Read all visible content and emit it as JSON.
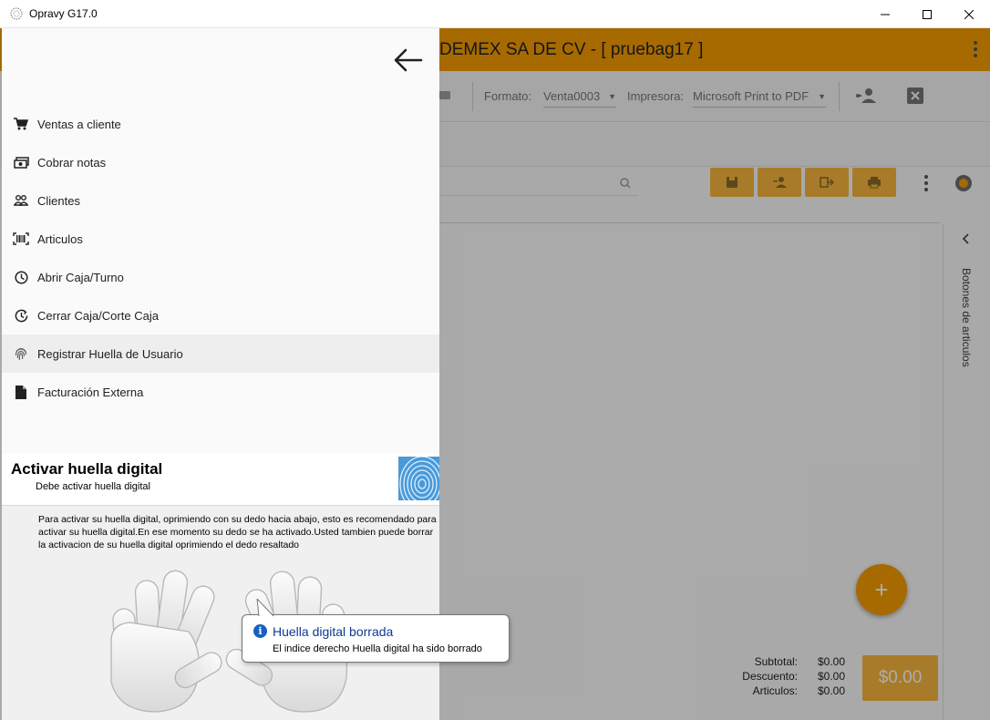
{
  "window": {
    "title": "Opravy G17.0"
  },
  "appbar": {
    "company": "DEMEX SA DE CV - [ pruebag17 ]"
  },
  "toolbar": {
    "formato_label": "Formato:",
    "formato_value": "Venta0003",
    "impresora_label": "Impresora:",
    "impresora_value": "Microsoft Print to PDF"
  },
  "side_panel": {
    "label": "Botones de articulos"
  },
  "totals": {
    "subtotal_label": "Subtotal:",
    "subtotal_value": "$0.00",
    "descuento_label": "Descuento:",
    "descuento_value": "$0.00",
    "articulos_label": "Articulos:",
    "articulos_value": "$0.00",
    "total_button": "$0.00"
  },
  "drawer": {
    "items": [
      {
        "label": "Ventas a cliente",
        "icon": "cart-icon"
      },
      {
        "label": "Cobrar notas",
        "icon": "money-icon"
      },
      {
        "label": "Clientes",
        "icon": "people-icon"
      },
      {
        "label": "Articulos",
        "icon": "barcode-icon"
      },
      {
        "label": "Abrir Caja/Turno",
        "icon": "clock-icon"
      },
      {
        "label": "Cerrar Caja/Corte Caja",
        "icon": "clock-restore-icon"
      },
      {
        "label": "Registrar Huella de Usuario",
        "icon": "fingerprint-icon"
      },
      {
        "label": "Facturación Externa",
        "icon": "document-icon"
      }
    ],
    "active_index": 6
  },
  "fingerprint": {
    "title": "Activar huella digital",
    "subtitle": "Debe activar huella digital",
    "description": "Para activar su huella digital, oprimiendo con su dedo hacia abajo, esto es recomendado para activar su huella digital.En ese momento su dedo se ha activado.Usted tambien puede borrar la activacion de su huella digital oprimiendo el dedo resaltado"
  },
  "balloon": {
    "title": "Huella digital borrada",
    "message": "El indice derecho Huella digital ha sido borrado"
  },
  "colors": {
    "appbar": "#f59c00",
    "accent": "#f7b53e",
    "info": "#1660c2"
  }
}
